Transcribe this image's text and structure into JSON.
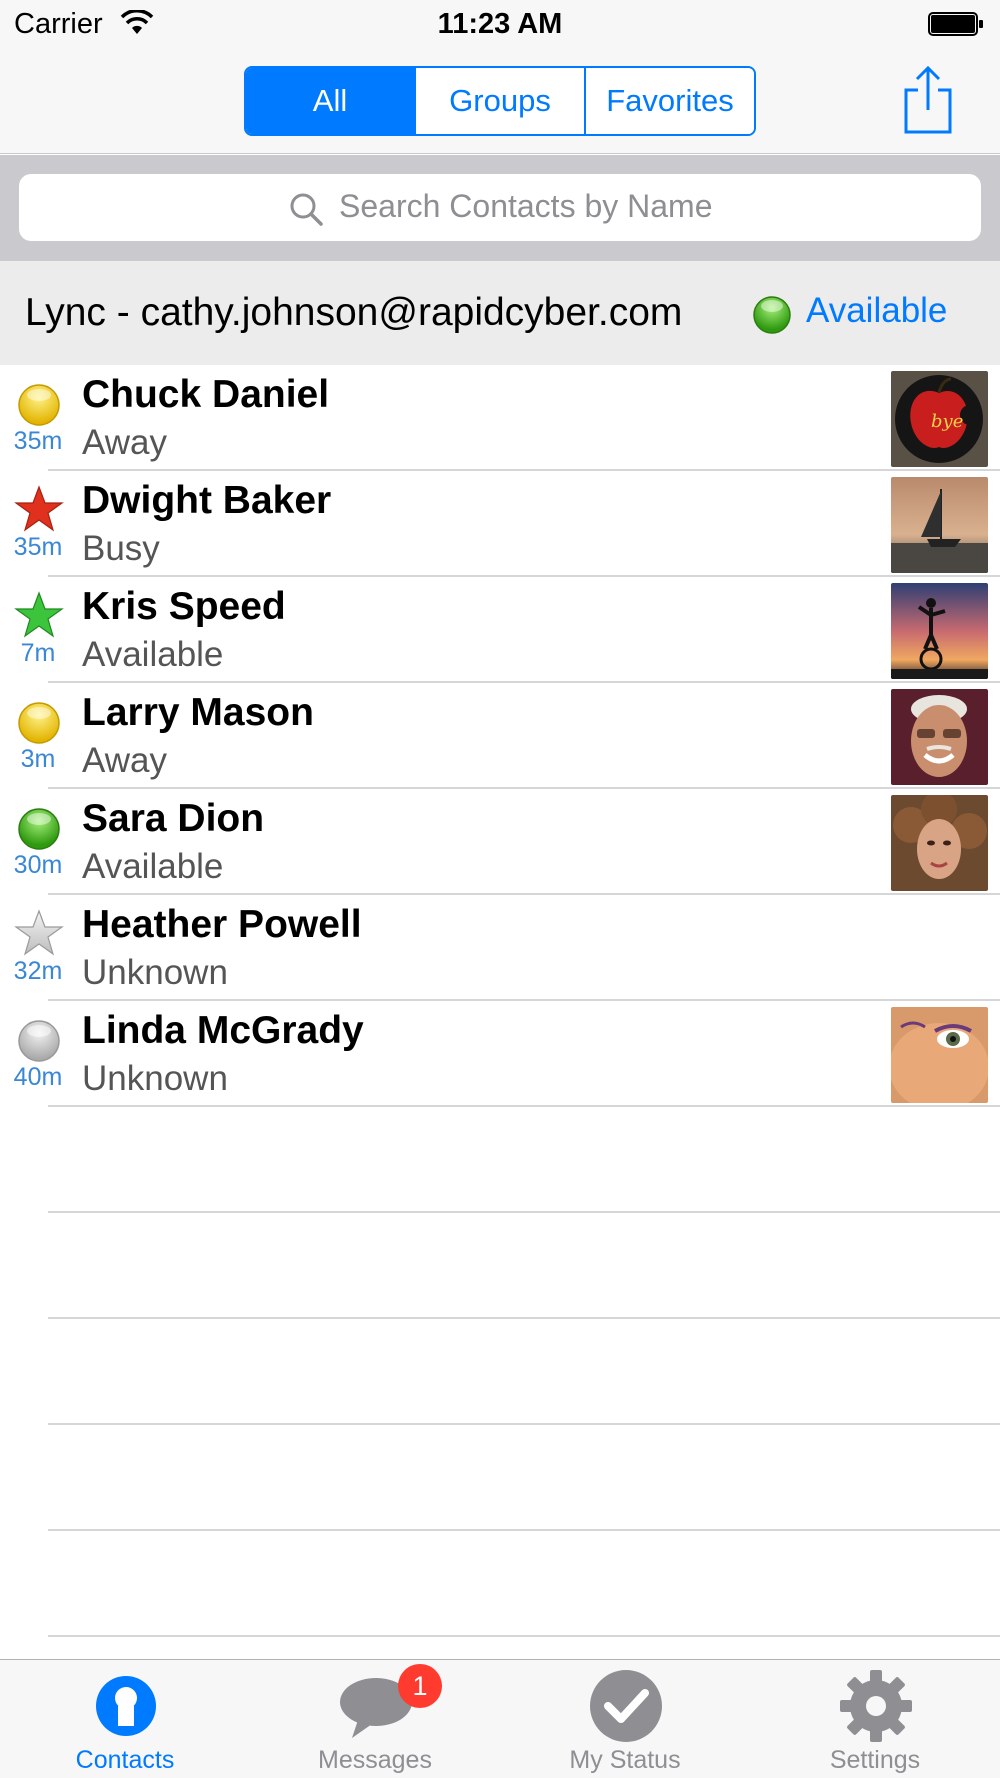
{
  "status_bar": {
    "carrier": "Carrier",
    "time": "11:23 AM"
  },
  "nav": {
    "segments": [
      "All",
      "Groups",
      "Favorites"
    ],
    "selected_segment": "All"
  },
  "search": {
    "placeholder": "Search Contacts by Name"
  },
  "account": {
    "label": "Lync - cathy.johnson@rapidcyber.com",
    "status": "Available",
    "status_color": "#4caf1a"
  },
  "contacts": [
    {
      "name": "Chuck Daniel",
      "status": "Away",
      "ago": "35m",
      "presence": "yellow-dot",
      "photo": "apple-logo-photo"
    },
    {
      "name": "Dwight Baker",
      "status": "Busy",
      "ago": "35m",
      "presence": "red-star",
      "photo": "sailboat-sunset-photo"
    },
    {
      "name": "Kris Speed",
      "status": "Available",
      "ago": "7m",
      "presence": "green-star",
      "photo": "unicycle-sunset-photo"
    },
    {
      "name": "Larry Mason",
      "status": "Away",
      "ago": "3m",
      "presence": "yellow-dot",
      "photo": "smiling-man-photo"
    },
    {
      "name": "Sara Dion",
      "status": "Available",
      "ago": "30m",
      "presence": "green-dot",
      "photo": "curly-hair-woman-photo"
    },
    {
      "name": "Heather Powell",
      "status": "Unknown",
      "ago": "32m",
      "presence": "gray-star",
      "photo": ""
    },
    {
      "name": "Linda McGrady",
      "status": "Unknown",
      "ago": "40m",
      "presence": "gray-dot",
      "photo": "woman-closeup-photo"
    }
  ],
  "tabs": [
    {
      "label": "Contacts",
      "icon": "contacts-icon",
      "active": true
    },
    {
      "label": "Messages",
      "icon": "messages-icon",
      "badge": "1"
    },
    {
      "label": "My Status",
      "icon": "my-status-icon"
    },
    {
      "label": "Settings",
      "icon": "settings-icon"
    }
  ],
  "colors": {
    "accent": "#007aff",
    "away": "#f5c800",
    "busy": "#e0301e",
    "available": "#3cc43c",
    "unknown": "#c4c4c4",
    "badge": "#ff3b30"
  }
}
